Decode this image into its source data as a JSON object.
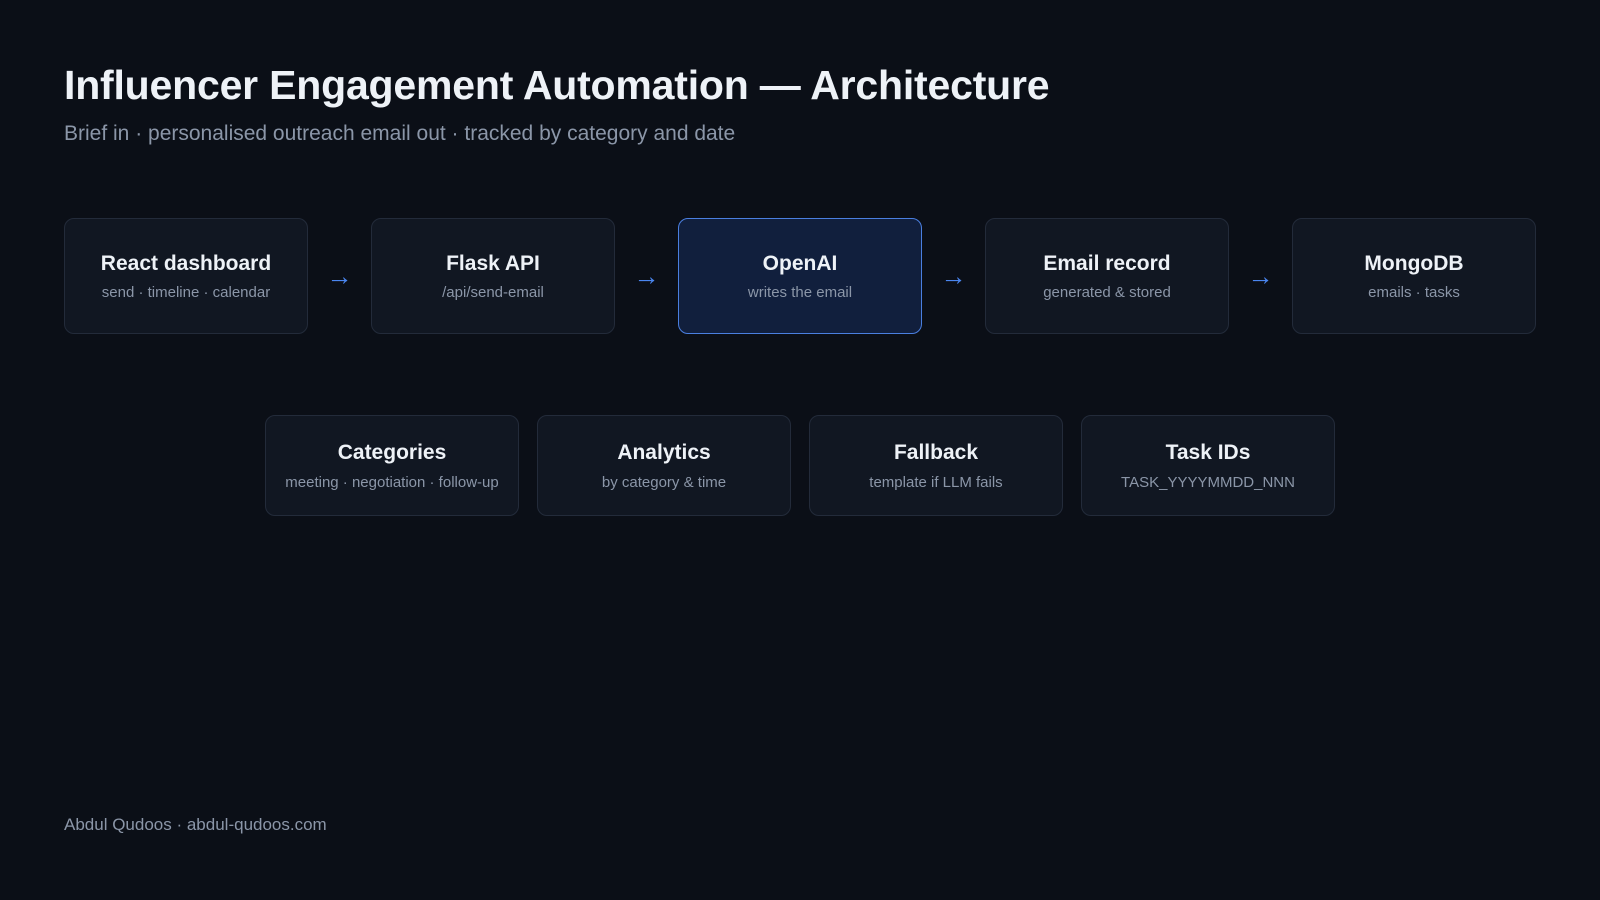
{
  "title": "Influencer Engagement Automation — Architecture",
  "subtitle": "Brief in · personalised outreach email out · tracked by category and date",
  "arrow_glyph": "→",
  "accent_color": "#4a86f0",
  "highlight_border_color": "#4a7fe0",
  "flow": [
    {
      "title": "React dashboard",
      "sub": "send · timeline · calendar"
    },
    {
      "title": "Flask API",
      "sub": "/api/send-email"
    },
    {
      "title": "OpenAI",
      "sub": "writes the email"
    },
    {
      "title": "Email record",
      "sub": "generated & stored"
    },
    {
      "title": "MongoDB",
      "sub": "emails · tasks"
    }
  ],
  "features": [
    {
      "title": "Categories",
      "sub": "meeting · negotiation · follow-up"
    },
    {
      "title": "Analytics",
      "sub": "by category & time"
    },
    {
      "title": "Fallback",
      "sub": "template if LLM fails"
    },
    {
      "title": "Task IDs",
      "sub": "TASK_YYYYMMDD_NNN"
    }
  ],
  "footer": "Abdul Qudoos · abdul-qudoos.com"
}
